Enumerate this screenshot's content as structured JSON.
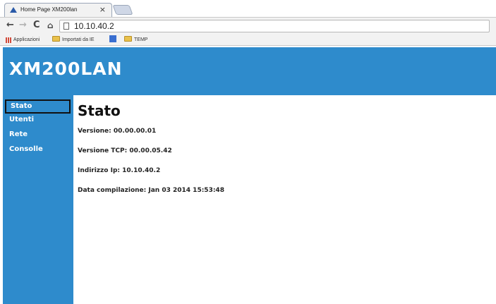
{
  "browser": {
    "tab": {
      "title": "Home Page XM200lan",
      "close_glyph": "×",
      "favicon": "triangle-icon"
    },
    "url": "10.10.40.2",
    "nav": {
      "back_glyph": "←",
      "forward_glyph": "→",
      "reload_glyph": "C",
      "home_glyph": "⌂"
    },
    "bookmarks": [
      {
        "label": "Applicazioni",
        "icon": "apps-grid-icon"
      },
      {
        "label": "Importati da IE",
        "icon": "folder-icon"
      },
      {
        "label": "",
        "icon": "blue-square-icon"
      },
      {
        "label": "TEMP",
        "icon": "folder-icon"
      }
    ]
  },
  "site": {
    "title": "XM200LAN",
    "accent_color": "#2e8bcc"
  },
  "sidebar": {
    "items": [
      {
        "label": "Stato",
        "active": true
      },
      {
        "label": "Utenti",
        "active": false
      },
      {
        "label": "Rete",
        "active": false
      },
      {
        "label": "Consolle",
        "active": false
      }
    ]
  },
  "main": {
    "title": "Stato",
    "lines": [
      "Versione: 00.00.00.01",
      "Versione TCP: 00.00.05.42",
      "Indirizzo Ip: 10.10.40.2",
      "Data compilazione: Jan 03 2014 15:53:48"
    ]
  }
}
